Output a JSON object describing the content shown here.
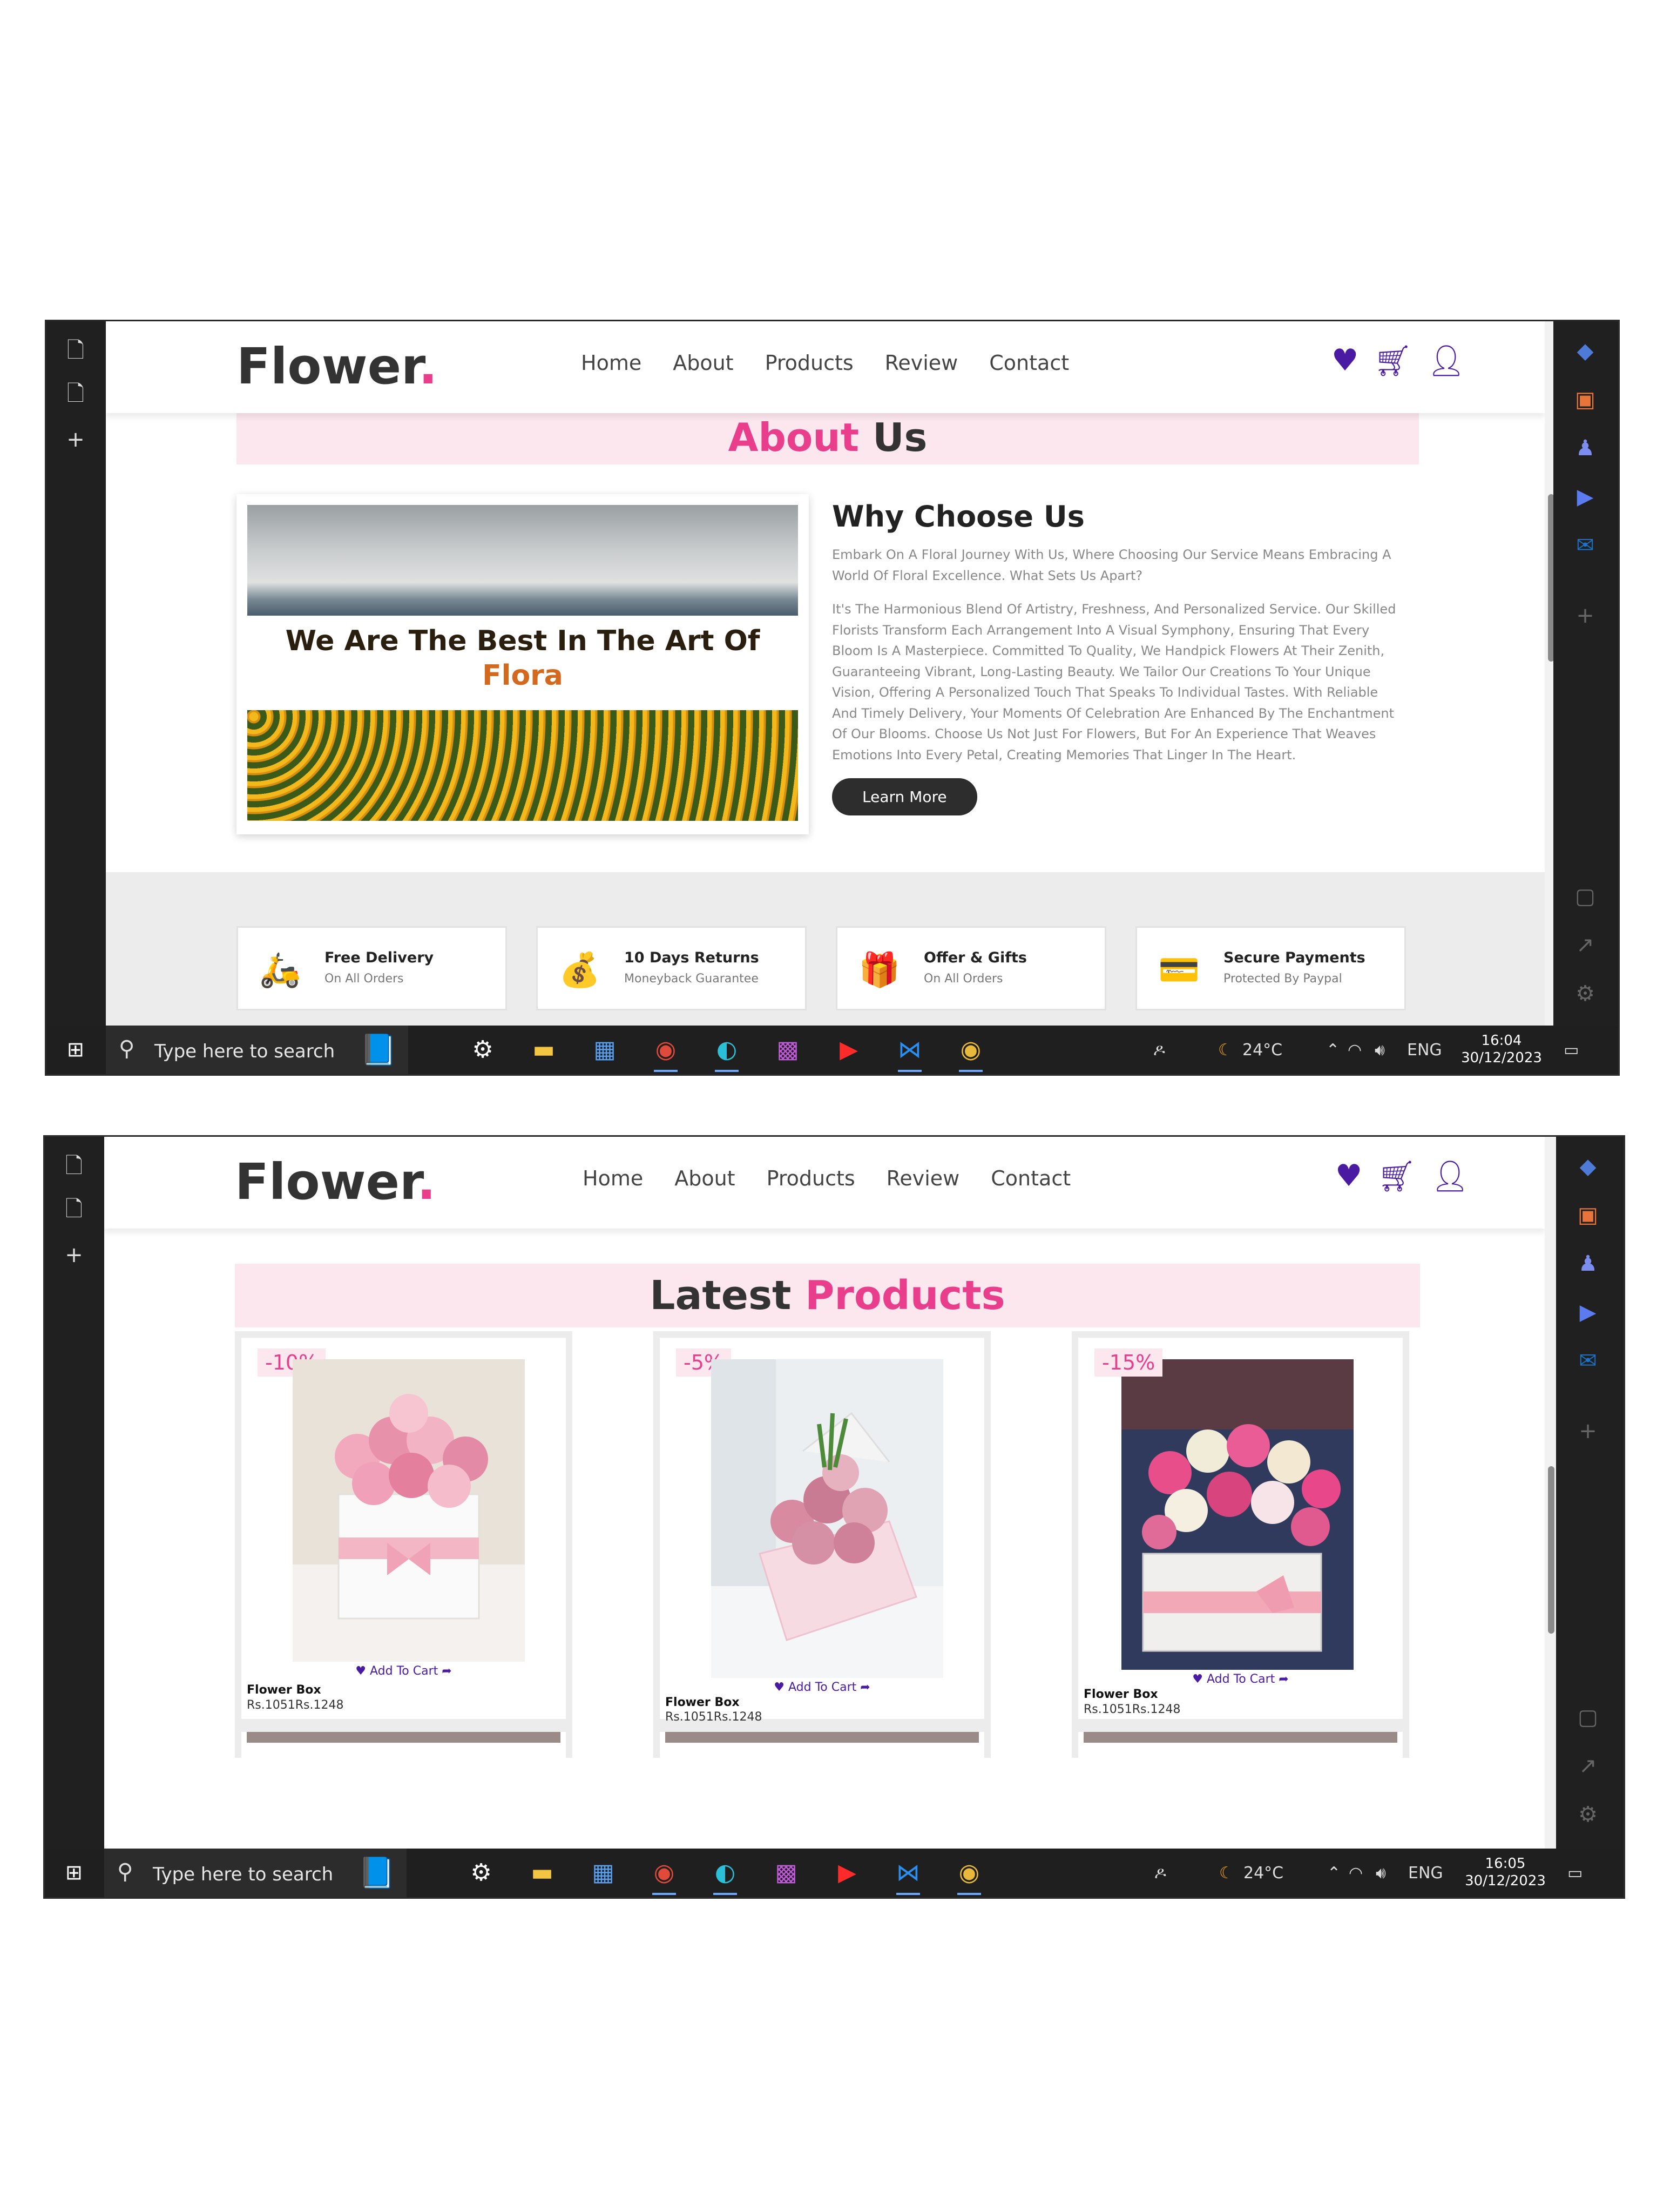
{
  "screens": [
    {
      "site": {
        "logo_text": "Flower",
        "logo_dot": "."
      },
      "nav": [
        "Home",
        "About",
        "Products",
        "Review",
        "Contact"
      ],
      "section_title": {
        "part1": "About",
        "part2": "Us"
      },
      "about_image_caption": {
        "line1": "We Are The Best In The Art Of",
        "line2": "Flora"
      },
      "why": {
        "heading": "Why Choose Us",
        "intro": "Embark On A Floral Journey With Us, Where Choosing Our Service Means Embracing A World Of Floral Excellence. What Sets Us Apart?",
        "body": "It's The Harmonious Blend Of Artistry, Freshness, And Personalized Service. Our Skilled Florists Transform Each Arrangement Into A Visual Symphony, Ensuring That Every Bloom Is A Masterpiece. Committed To Quality, We Handpick Flowers At Their Zenith, Guaranteeing Vibrant, Long-Lasting Beauty. We Tailor Our Creations To Your Unique Vision, Offering A Personalized Touch That Speaks To Individual Tastes. With Reliable And Timely Delivery, Your Moments Of Celebration Are Enhanced By The Enchantment Of Our Blooms. Choose Us Not Just For Flowers, But For An Experience That Weaves Emotions Into Every Petal, Creating Memories That Linger In The Heart.",
        "button": "Learn More"
      },
      "features": [
        {
          "title": "Free Delivery",
          "sub": "On All Orders",
          "icon": "delivery-icon"
        },
        {
          "title": "10 Days Returns",
          "sub": "Moneyback Guarantee",
          "icon": "returns-icon"
        },
        {
          "title": "Offer & Gifts",
          "sub": "On All Orders",
          "icon": "gift-icon"
        },
        {
          "title": "Secure Payments",
          "sub": "Protected By Paypal",
          "icon": "payment-icon"
        }
      ],
      "taskbar": {
        "search_placeholder": "Type here to search",
        "weather": "24°C",
        "lang": "ENG",
        "time": "16:04",
        "date": "30/12/2023"
      }
    },
    {
      "site": {
        "logo_text": "Flower",
        "logo_dot": "."
      },
      "nav": [
        "Home",
        "About",
        "Products",
        "Review",
        "Contact"
      ],
      "section_title": {
        "part1": "Latest",
        "part2": "Products"
      },
      "products": [
        {
          "discount": "-10%",
          "add_to_cart": "Add To Cart",
          "name": "Flower Box",
          "price": "Rs.1051Rs.1248"
        },
        {
          "discount": "-5%",
          "add_to_cart": "Add To Cart",
          "name": "Flower Box",
          "price": "Rs.1051Rs.1248"
        },
        {
          "discount": "-15%",
          "add_to_cart": "Add To Cart",
          "name": "Flower Box",
          "price": "Rs.1051Rs.1248"
        }
      ],
      "taskbar": {
        "search_placeholder": "Type here to search",
        "weather": "24°C",
        "lang": "ENG",
        "time": "16:05",
        "date": "30/12/2023"
      }
    }
  ],
  "colors": {
    "accent_pink": "#e83e8c",
    "icon_purple": "#4b1aa3",
    "title_bg": "#fde7ef",
    "taskbar": "#1f1f1f"
  }
}
